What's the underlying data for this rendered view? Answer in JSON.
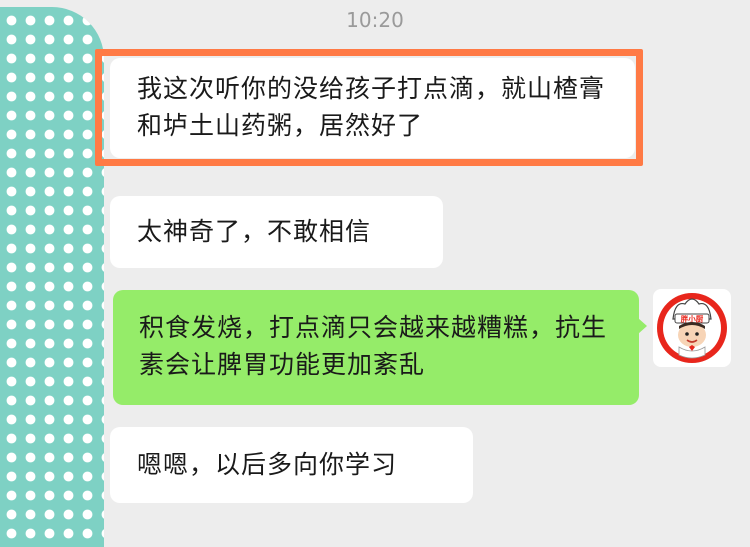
{
  "chat": {
    "timestamp": "10:20",
    "messages": [
      {
        "sender": "contact",
        "text": "我这次听你的没给孩子打点滴，就山楂膏和垆土山药粥，居然好了"
      },
      {
        "sender": "contact",
        "text": "太神奇了，不敢相信"
      },
      {
        "sender": "self",
        "text": "积食发烧，打点滴只会越来越糟糕，抗生素会让脾胃功能更加紊乱"
      },
      {
        "sender": "contact",
        "text": "嗯嗯，以后多向你学习"
      }
    ]
  },
  "avatars": {
    "contact": {
      "icon": "polka-dot-avatar-icon",
      "color": "#7ed1c4"
    },
    "self": {
      "icon": "chef-avatar-icon",
      "logo_text": "胖小厨"
    }
  },
  "colors": {
    "background": "#ededed",
    "incoming_bubble": "#ffffff",
    "outgoing_bubble": "#95ec69",
    "highlight_border": "#ff7a45",
    "timestamp_text": "#9a9a9a"
  }
}
